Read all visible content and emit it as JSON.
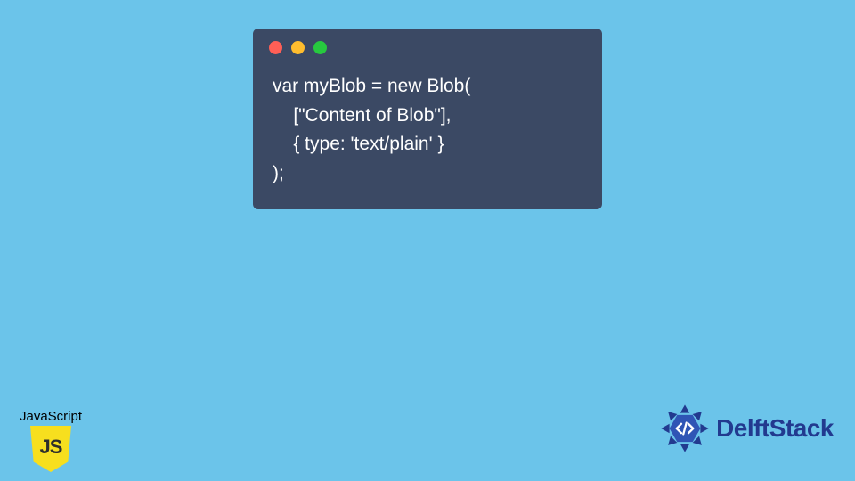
{
  "code_window": {
    "dots": [
      "red",
      "yellow",
      "green"
    ],
    "lines": [
      "var myBlob = new Blob(",
      "    [\"Content of Blob\"],",
      "    { type: 'text/plain' }",
      ");"
    ]
  },
  "js_badge": {
    "label": "JavaScript",
    "shield_text": "JS"
  },
  "delft": {
    "text": "DelftStack",
    "icon_name": "delftstack-logo"
  },
  "colors": {
    "background": "#6bc4ea",
    "window": "#3b4964",
    "js_yellow": "#f7df1e",
    "brand_blue": "#223a8f"
  }
}
